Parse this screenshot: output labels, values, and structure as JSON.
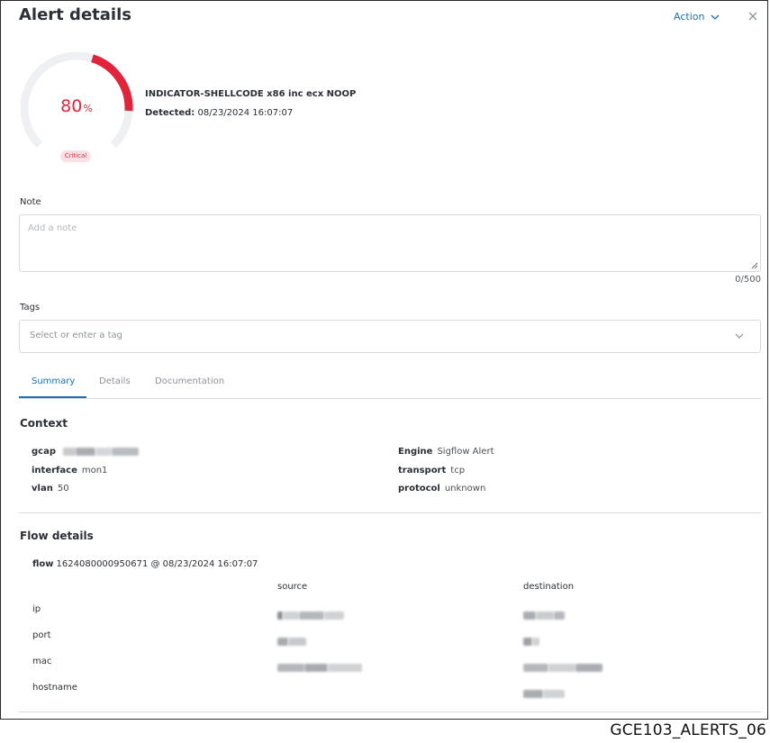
{
  "header": {
    "title": "Alert details",
    "action_label": "Action"
  },
  "alert": {
    "score_value": "80",
    "score_unit": "%",
    "score_fraction": 0.8,
    "severity": "Critical",
    "name": "INDICATOR-SHELLCODE x86 inc ecx NOOP",
    "detected_label": "Detected:",
    "detected_value": "08/23/2024 16:07:07"
  },
  "note": {
    "label": "Note",
    "placeholder": "Add a note",
    "value": "",
    "counter": "0/500"
  },
  "tags": {
    "label": "Tags",
    "placeholder": "Select or enter a tag"
  },
  "tabs": [
    {
      "label": "Summary",
      "active": true
    },
    {
      "label": "Details",
      "active": false
    },
    {
      "label": "Documentation",
      "active": false
    }
  ],
  "context": {
    "title": "Context",
    "left": [
      {
        "key": "gcap",
        "value": ""
      },
      {
        "key": "interface",
        "value": "mon1"
      },
      {
        "key": "vlan",
        "value": "50"
      }
    ],
    "right": [
      {
        "key": "Engine",
        "value": "Sigflow Alert"
      },
      {
        "key": "transport",
        "value": "tcp"
      },
      {
        "key": "protocol",
        "value": "unknown"
      }
    ]
  },
  "flow": {
    "title": "Flow details",
    "flow_key": "flow",
    "flow_value": "1624080000950671 @ 08/23/2024 16:07:07",
    "columns": [
      "source",
      "destination"
    ],
    "rows": [
      {
        "label": "ip"
      },
      {
        "label": "port"
      },
      {
        "label": "mac"
      },
      {
        "label": "hostname"
      }
    ]
  },
  "caption": "GCE103_ALERTS_06",
  "colors": {
    "accent": "#1f6fb2",
    "critical": "#e0243b",
    "gauge_track": "#eef0f3",
    "border": "#d7dadf"
  }
}
